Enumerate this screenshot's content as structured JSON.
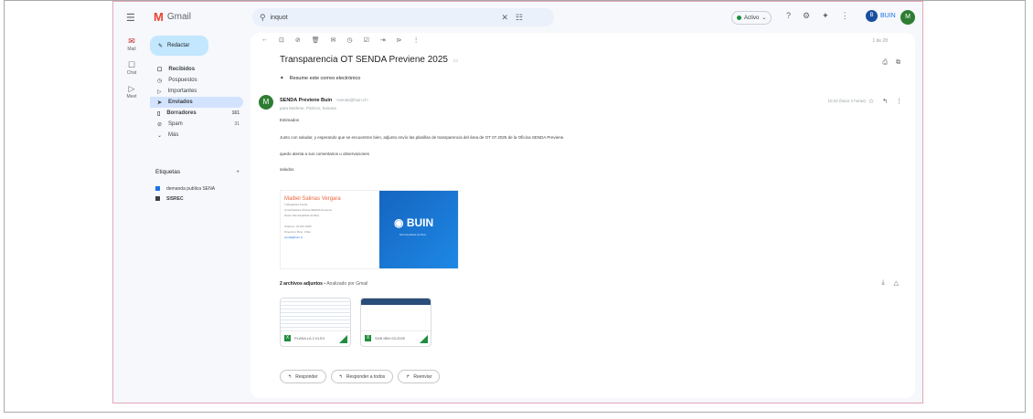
{
  "app": {
    "name": "Gmail",
    "logo_glyph": "M"
  },
  "search": {
    "value": "inquot"
  },
  "status": {
    "label": "Activo"
  },
  "account": {
    "org_badge": "BUIN",
    "avatar_letter": "M"
  },
  "rail": [
    {
      "label": "Mail",
      "icon": "mail-icon",
      "glyph": "✉"
    },
    {
      "label": "Chat",
      "icon": "chat-icon",
      "glyph": "☐"
    },
    {
      "label": "Meet",
      "icon": "meet-icon",
      "glyph": "▷"
    }
  ],
  "compose": {
    "label": "Redactar"
  },
  "nav": [
    {
      "label": "Recibidos",
      "icon": "inbox-icon",
      "glyph": "☐",
      "count": "",
      "bold": true
    },
    {
      "label": "Pospuestos",
      "icon": "clock-icon",
      "glyph": "◷",
      "count": ""
    },
    {
      "label": "Importantes",
      "icon": "important-icon",
      "glyph": "▷",
      "count": ""
    },
    {
      "label": "Enviados",
      "icon": "send-icon",
      "glyph": "➤",
      "count": "",
      "selected": true
    },
    {
      "label": "Borradores",
      "icon": "draft-icon",
      "glyph": "▯",
      "count": "161"
    },
    {
      "label": "Spam",
      "icon": "spam-icon",
      "glyph": "⊘",
      "count": "31"
    },
    {
      "label": "Más",
      "icon": "chevron-down-icon",
      "glyph": "⌄",
      "count": ""
    }
  ],
  "labels": {
    "title": "Etiquetas",
    "items": [
      {
        "label": "demanda publica SENA",
        "color": "#1a73e8"
      },
      {
        "label": "SISREC",
        "color": "#3c4043"
      }
    ]
  },
  "toolbar": {
    "pager": "1 de 28"
  },
  "email": {
    "subject": "Transparencia OT SENDA Previene 2025",
    "summary_label": "Resume este correo electrónico",
    "sender_name": "SENDA Previene Buin",
    "sender_email": "<senda@buin.cl>",
    "recipients": "para Marlene, Patricio, Susana",
    "date": "10:22 (hace 2 horas)",
    "greeting": "Estimados",
    "paragraph": "Junto con saludar, y esperando que se encuentren bien, adjunto envío las planillas de transparencia del área de  OT 07.2025 de la Oficina SENDA Previene.",
    "closing1": "quedo atenta a sus comentarios u observaciones",
    "closing2": "saludos"
  },
  "signature": {
    "name": "Maibel Salinas Vergara",
    "lines": [
      "Trabajadora Social",
      "Coordinadora Oficina SENDA Previene",
      "Ilustre Municipalidad de Buin",
      "",
      "Teléfono: 22 821 0000",
      "Dirección: Buin, Chile",
      "senda@buin.cl"
    ],
    "logo_text": "BUIN",
    "logo_sub": "Municipalidad de Buin"
  },
  "attachments": {
    "header_count": "2 archivos adjuntos",
    "header_suffix": "• Analizado por Gmail",
    "items": [
      {
        "name": "PLANILLA 2.XLSX",
        "kind": "sheet"
      },
      {
        "name": "SUB IBIN 03-2025",
        "kind": "doc"
      }
    ]
  },
  "actions": [
    {
      "label": "Responder",
      "glyph": "↰"
    },
    {
      "label": "Responder a todos",
      "glyph": "↰"
    },
    {
      "label": "Reenviar",
      "glyph": "↱"
    }
  ]
}
